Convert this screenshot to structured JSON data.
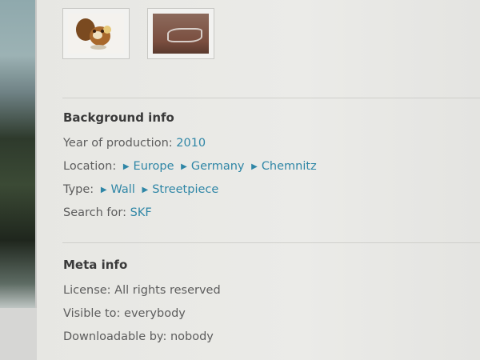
{
  "thumbnails": [
    {
      "name": "thumbnail-cartoon"
    },
    {
      "name": "thumbnail-wall"
    }
  ],
  "background_info": {
    "heading": "Background info",
    "year_label": "Year of production:",
    "year_value": "2010",
    "location_label": "Location:",
    "location_path": [
      "Europe",
      "Germany",
      "Chemnitz"
    ],
    "type_label": "Type:",
    "type_path": [
      "Wall",
      "Streetpiece"
    ],
    "search_label": "Search for:",
    "search_value": "SKF",
    "breadcrumb_icon": "chevron-right-icon"
  },
  "meta_info": {
    "heading": "Meta info",
    "license": "License: All rights reserved",
    "visible_to": "Visible to: everybody",
    "downloadable_by": "Downloadable by: nobody"
  },
  "colors": {
    "link": "#2f86a6",
    "text": "#5d5d5d",
    "heading": "#3a3a3a"
  }
}
